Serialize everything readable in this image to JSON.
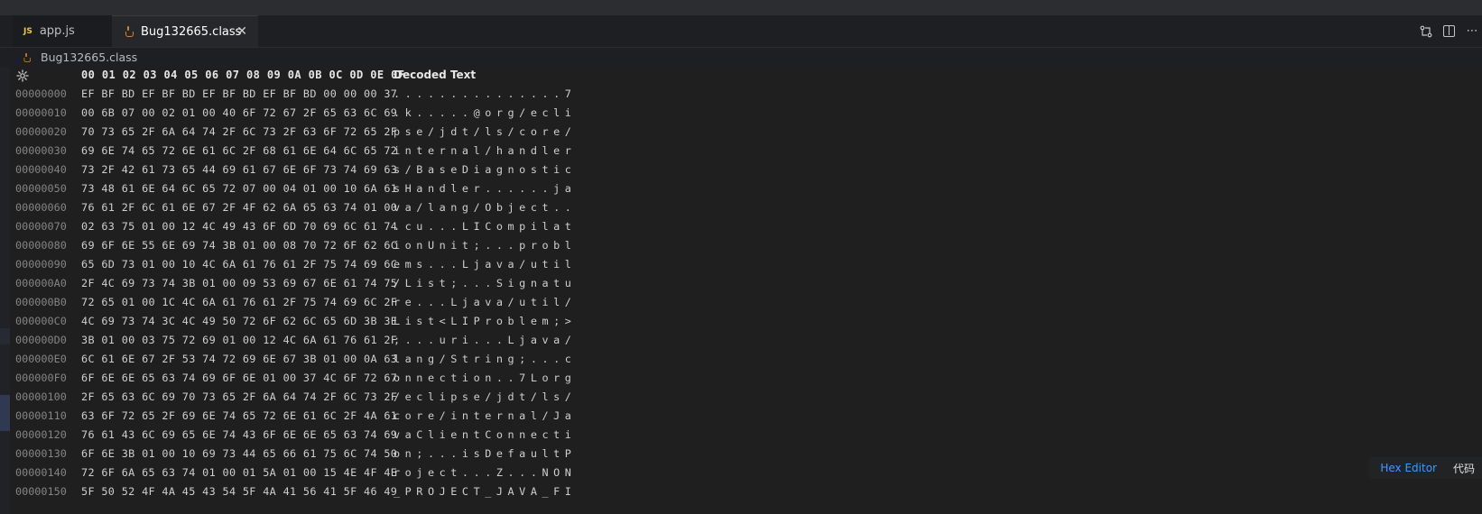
{
  "tabs": [
    {
      "icon": "JS",
      "label": "app.js"
    },
    {
      "label": "Bug132665.class",
      "close": "✕"
    }
  ],
  "breadcrumb": {
    "file": "Bug132665.class"
  },
  "hex": {
    "header_bytes": "00 01 02 03 04 05 06 07 08 09 0A 0B 0C 0D 0E 0F",
    "header_decoded": "Decoded Text",
    "rows": [
      {
        "addr": "00000000",
        "bytes": "EF BF BD EF BF BD EF BF BD EF BF BD 00 00 00 37",
        "text": "...............7"
      },
      {
        "addr": "00000010",
        "bytes": "00 6B 07 00 02 01 00 40 6F 72 67 2F 65 63 6C 69",
        "text": ".k.....@org/ecli"
      },
      {
        "addr": "00000020",
        "bytes": "70 73 65 2F 6A 64 74 2F 6C 73 2F 63 6F 72 65 2F",
        "text": "pse/jdt/ls/core/"
      },
      {
        "addr": "00000030",
        "bytes": "69 6E 74 65 72 6E 61 6C 2F 68 61 6E 64 6C 65 72",
        "text": "internal/handler"
      },
      {
        "addr": "00000040",
        "bytes": "73 2F 42 61 73 65 44 69 61 67 6E 6F 73 74 69 63",
        "text": "s/BaseDiagnostic"
      },
      {
        "addr": "00000050",
        "bytes": "73 48 61 6E 64 6C 65 72 07 00 04 01 00 10 6A 61",
        "text": "sHandler......ja"
      },
      {
        "addr": "00000060",
        "bytes": "76 61 2F 6C 61 6E 67 2F 4F 62 6A 65 63 74 01 00",
        "text": "va/lang/Object.."
      },
      {
        "addr": "00000070",
        "bytes": "02 63 75 01 00 12 4C 49 43 6F 6D 70 69 6C 61 74",
        "text": ".cu...LICompilat"
      },
      {
        "addr": "00000080",
        "bytes": "69 6F 6E 55 6E 69 74 3B 01 00 08 70 72 6F 62 6C",
        "text": "ionUnit;...probl"
      },
      {
        "addr": "00000090",
        "bytes": "65 6D 73 01 00 10 4C 6A 61 76 61 2F 75 74 69 6C",
        "text": "ems...Ljava/util"
      },
      {
        "addr": "000000A0",
        "bytes": "2F 4C 69 73 74 3B 01 00 09 53 69 67 6E 61 74 75",
        "text": "/List;...Signatu"
      },
      {
        "addr": "000000B0",
        "bytes": "72 65 01 00 1C 4C 6A 61 76 61 2F 75 74 69 6C 2F",
        "text": "re...Ljava/util/"
      },
      {
        "addr": "000000C0",
        "bytes": "4C 69 73 74 3C 4C 49 50 72 6F 62 6C 65 6D 3B 3E",
        "text": "List<LIProblem;>"
      },
      {
        "addr": "000000D0",
        "bytes": "3B 01 00 03 75 72 69 01 00 12 4C 6A 61 76 61 2F",
        "text": ";...uri...Ljava/"
      },
      {
        "addr": "000000E0",
        "bytes": "6C 61 6E 67 2F 53 74 72 69 6E 67 3B 01 00 0A 63",
        "text": "lang/String;...c"
      },
      {
        "addr": "000000F0",
        "bytes": "6F 6E 6E 65 63 74 69 6F 6E 01 00 37 4C 6F 72 67",
        "text": "onnection..7Lorg"
      },
      {
        "addr": "00000100",
        "bytes": "2F 65 63 6C 69 70 73 65 2F 6A 64 74 2F 6C 73 2F",
        "text": "/eclipse/jdt/ls/"
      },
      {
        "addr": "00000110",
        "bytes": "63 6F 72 65 2F 69 6E 74 65 72 6E 61 6C 2F 4A 61",
        "text": "core/internal/Ja"
      },
      {
        "addr": "00000120",
        "bytes": "76 61 43 6C 69 65 6E 74 43 6F 6E 6E 65 63 74 69",
        "text": "vaClientConnecti"
      },
      {
        "addr": "00000130",
        "bytes": "6F 6E 3B 01 00 10 69 73 44 65 66 61 75 6C 74 50",
        "text": "on;...isDefaultP"
      },
      {
        "addr": "00000140",
        "bytes": "72 6F 6A 65 63 74 01 00 01 5A 01 00 15 4E 4F 4E",
        "text": "roject...Z...NON"
      },
      {
        "addr": "00000150",
        "bytes": "5F 50 52 4F 4A 45 43 54 5F 4A 41 56 41 5F 46 49",
        "text": "_PROJECT_JAVA_FI"
      }
    ]
  },
  "status": {
    "editor_link": "Hex Editor",
    "code_label": "代码"
  },
  "icons": {
    "right_toolbar": [
      "compare-changes-icon",
      "split-editor-icon",
      "more-actions-icon"
    ]
  }
}
